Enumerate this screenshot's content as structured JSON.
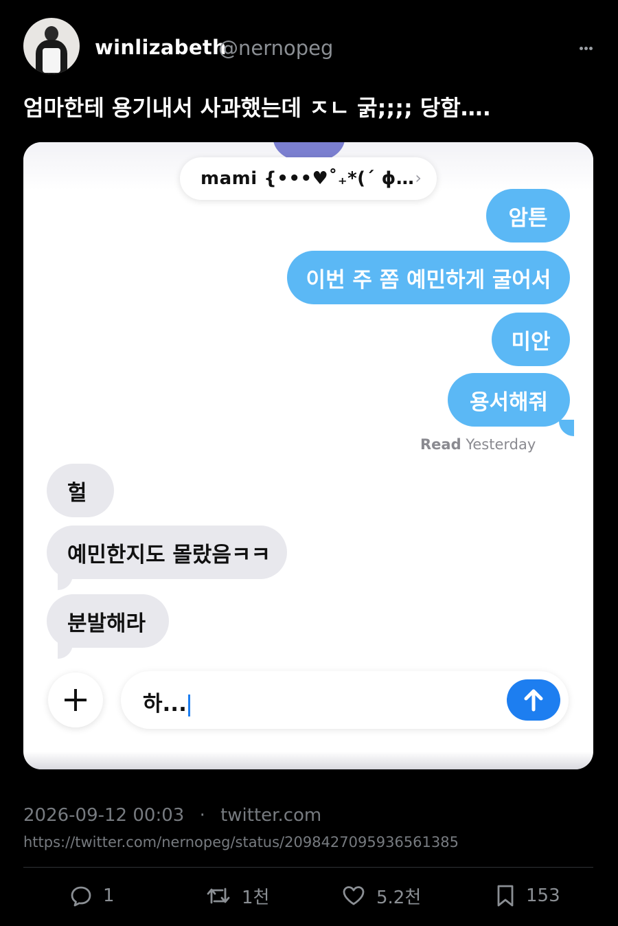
{
  "author": {
    "name": "winlizabeth",
    "handle": "@nernopeg"
  },
  "tweet": {
    "text": "엄마한테 용기내서 사과했는데 ㅈㄴ 굵;;;; 당함….",
    "timestamp": "2026-09-12 00:03",
    "source": "twitter.com",
    "separator": "·",
    "url": "https://twitter.com/nernopeg/status/2098427095936561385"
  },
  "chat": {
    "contact_name": "mami {•••♥˚₊*(´ ɸ…",
    "outgoing": [
      "암튼",
      "이번 주 쫌 예민하게 굴어서",
      "미안",
      "용서해줘"
    ],
    "read_label": "Read",
    "read_time": "Yesterday",
    "incoming": [
      "헐",
      "예민한지도 몰랐음ㅋㅋ",
      "분발해라"
    ],
    "input_value": "하..."
  },
  "actions": {
    "replies": "1",
    "retweets": "1천",
    "likes": "5.2천",
    "bookmarks": "153"
  },
  "colors": {
    "outgoing_bubble": "#5bb8f5",
    "incoming_bubble": "#e8e8ed",
    "send_button": "#1d7ef0"
  }
}
